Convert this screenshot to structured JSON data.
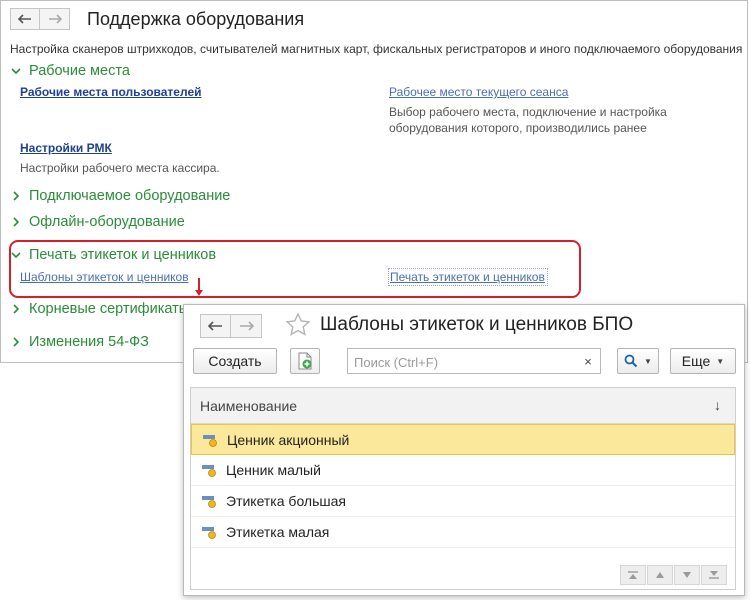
{
  "main_window": {
    "title": "Поддержка оборудования",
    "description": "Настройка сканеров штрихкодов, считывателей магнитных карт, фискальных регистраторов и иного подключаемого оборудования",
    "sections": {
      "workplaces": {
        "label": "Рабочие места",
        "link_user_workplaces": "Рабочие места пользователей",
        "link_current_session": "Рабочее место текущего сеанса",
        "current_session_desc_1": "Выбор рабочего места, подключение и настройка",
        "current_session_desc_2": "оборудования которого, производились ранее",
        "link_rmk": "Настройки РМК",
        "rmk_desc": "Настройки рабочего места кассира."
      },
      "connected_equipment": {
        "label": "Подключаемое оборудование"
      },
      "offline_equipment": {
        "label": "Офлайн-оборудование"
      },
      "label_printing": {
        "label": "Печать этикеток и ценников",
        "link_templates": "Шаблоны этикеток и ценников",
        "link_print": "Печать этикеток и ценников"
      },
      "root_certificates": {
        "label": "Корневые сертификаты"
      },
      "changes_54fz": {
        "label": "Изменения 54-ФЗ"
      }
    }
  },
  "popup": {
    "title": "Шаблоны этикеток и ценников БПО",
    "toolbar": {
      "create_label": "Создать",
      "search_placeholder": "Поиск (Ctrl+F)",
      "clear_symbol": "×",
      "more_label": "Еще"
    },
    "table": {
      "column_header": "Наименование",
      "sort_symbol": "↓",
      "rows": [
        {
          "name": "Ценник акционный",
          "selected": true
        },
        {
          "name": "Ценник малый",
          "selected": false
        },
        {
          "name": "Этикетка большая",
          "selected": false
        },
        {
          "name": "Этикетка малая",
          "selected": false
        }
      ]
    }
  },
  "colors": {
    "section_green": "#2b8c3a",
    "link_blue": "#1b4f9c",
    "highlight_red": "#d61f2c",
    "selected_row": "#fbe89a"
  }
}
